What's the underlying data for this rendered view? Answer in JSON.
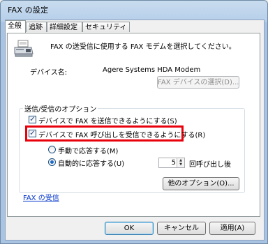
{
  "window": {
    "title": "FAX の設定"
  },
  "tabs": [
    {
      "label": "全般"
    },
    {
      "label": "追跡"
    },
    {
      "label": "詳細設定"
    },
    {
      "label": "セキュリティ"
    }
  ],
  "general": {
    "description": "FAX の送受信に使用する FAX モデムを選択してください。",
    "device_label": "デバイス名:",
    "device_value": "Agere Systems HDA Modem",
    "select_device_button": "FAX デバイスの選択(D)...",
    "options_group_title": "送信/受信のオプション",
    "send_checkbox_label": "デバイスで FAX を送信できるようにする(S)",
    "send_checked": true,
    "receive_checkbox_label": "デバイスで FAX 呼び出しを受信できるようにする(R)",
    "receive_checked": true,
    "manual_answer_label": "手動で応答する(M)",
    "auto_answer_label": "自動的に応答する(U)",
    "rings_value": "5",
    "rings_suffix": "回呼び出し後",
    "other_options_button": "他のオプション(O)...",
    "fax_receive_link": "FAX の受信"
  },
  "footer": {
    "ok": "OK",
    "cancel": "キャンセル",
    "apply": "適用(A)"
  },
  "colors": {
    "highlight": "#e8000b",
    "link": "#0033cc"
  }
}
